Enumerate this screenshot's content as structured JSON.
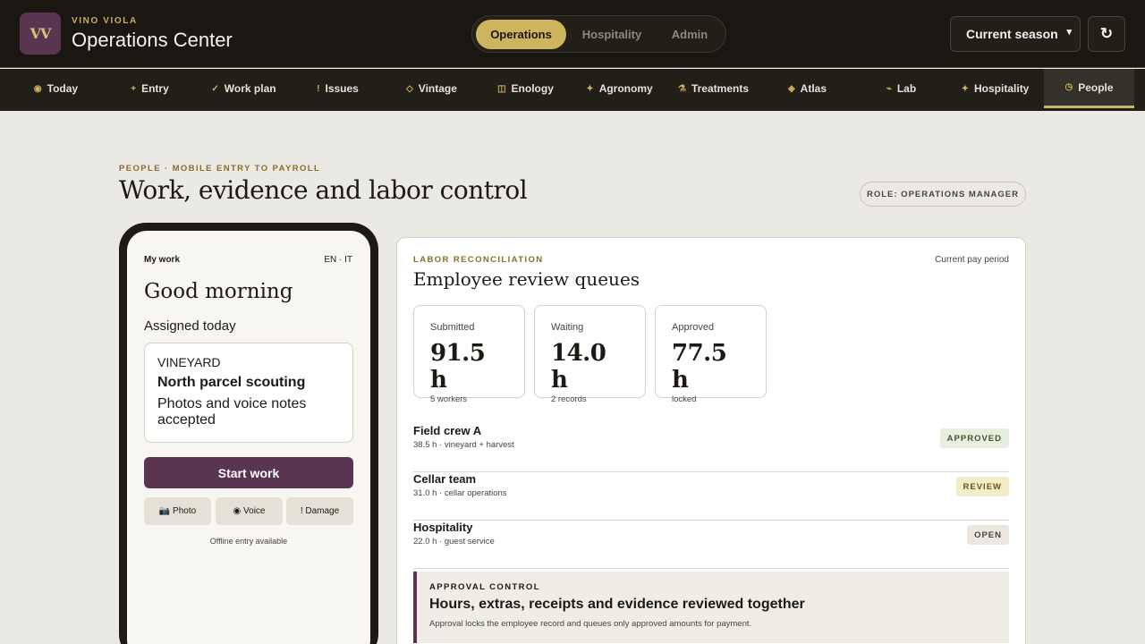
{
  "header": {
    "logo_text": "VV",
    "brand_sub": "VINO VIOLA",
    "title": "Operations Center",
    "modes": [
      "Operations",
      "Hospitality",
      "Admin"
    ],
    "season": "Current season",
    "refresh_glyph": "↻"
  },
  "nav": [
    {
      "icon": "◉",
      "label": "Today"
    },
    {
      "icon": "+",
      "label": "Entry"
    },
    {
      "icon": "✓",
      "label": "Work plan"
    },
    {
      "icon": "!",
      "label": "Issues"
    },
    {
      "icon": "◇",
      "label": "Vintage"
    },
    {
      "icon": "◫",
      "label": "Enology"
    },
    {
      "icon": "✦",
      "label": "Agronomy"
    },
    {
      "icon": "⚗",
      "label": "Treatments"
    },
    {
      "icon": "◈",
      "label": "Atlas"
    },
    {
      "icon": "⌁",
      "label": "Lab"
    },
    {
      "icon": "✦",
      "label": "Hospitality"
    },
    {
      "icon": "◷",
      "label": "People"
    }
  ],
  "page": {
    "eyebrow": "PEOPLE · MOBILE ENTRY TO PAYROLL",
    "title": "Work, evidence and labor control",
    "role": "ROLE: OPERATIONS MANAGER"
  },
  "phone": {
    "top_label": "My work",
    "lang": "EN · IT",
    "greeting": "Good morning",
    "assigned": "Assigned today",
    "card_kind": "VINEYARD",
    "card_title": "North parcel scouting",
    "card_desc": "Photos and voice notes accepted",
    "start": "Start work",
    "photo": "📷 Photo",
    "voice": "◉ Voice",
    "damage": "! Damage",
    "offline": "Offline entry available"
  },
  "panel": {
    "eyebrow": "LABOR RECONCILIATION",
    "period": "Current pay period",
    "title": "Employee review queues",
    "stats": [
      {
        "label": "Submitted",
        "value": "91.5 h",
        "sub": "5 workers"
      },
      {
        "label": "Waiting",
        "value": "14.0 h",
        "sub": "2 records"
      },
      {
        "label": "Approved",
        "value": "77.5 h",
        "sub": "locked"
      }
    ],
    "teams": [
      {
        "name": "Field crew A",
        "meta": "38.5 h · vineyard + harvest",
        "status": "APPROVED"
      },
      {
        "name": "Cellar team",
        "meta": "31.0 h · cellar operations",
        "status": "REVIEW"
      },
      {
        "name": "Hospitality",
        "meta": "22.0 h · guest service",
        "status": "OPEN"
      }
    ],
    "approval": {
      "eyebrow": "APPROVAL CONTROL",
      "title": "Hours, extras, receipts and evidence reviewed together",
      "desc": "Approval locks the employee record and queues only approved amounts for payment."
    }
  }
}
